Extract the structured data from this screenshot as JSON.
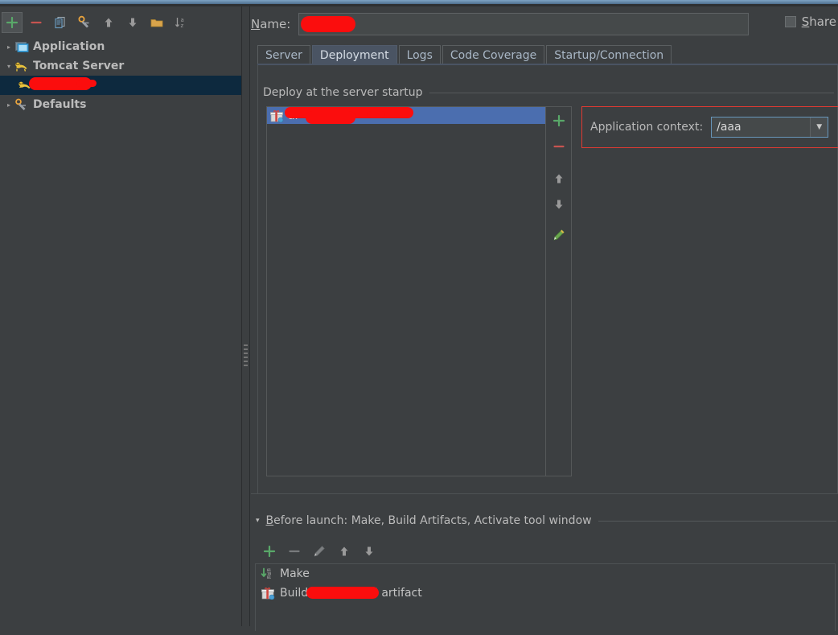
{
  "window": {
    "accent_title_color": "#6f96b8",
    "background": "#3c3f41",
    "selection_blue": "#4b6eaf",
    "tree_selection": "#0d293e",
    "redaction_color": "#fb0d0d",
    "error_border": "#e03a32",
    "focus_border": "#6897bb"
  },
  "left_toolbar": {
    "buttons": [
      {
        "name": "add-configuration-button",
        "icon": "plus-icon",
        "label": "Add New Configuration"
      },
      {
        "name": "remove-configuration-button",
        "icon": "minus-icon",
        "label": "Remove Configuration"
      },
      {
        "name": "copy-configuration-button",
        "icon": "copy-icon",
        "label": "Copy Configuration"
      },
      {
        "name": "edit-defaults-button",
        "icon": "wrench-icon",
        "label": "Edit defaults"
      },
      {
        "name": "move-up-button",
        "icon": "arrow-up-icon",
        "label": "Move Up"
      },
      {
        "name": "move-down-button",
        "icon": "arrow-down-icon",
        "label": "Move Down"
      },
      {
        "name": "create-folder-button",
        "icon": "folder-icon",
        "label": "Create New Folder"
      },
      {
        "name": "sort-button",
        "icon": "sort-az-icon",
        "label": "Sort Configurations"
      }
    ]
  },
  "tree": {
    "items": [
      {
        "label": "Application",
        "icon": "application-icon",
        "expanded": false,
        "level": 1,
        "selected": false,
        "redacted": false
      },
      {
        "label": "Tomcat Server",
        "icon": "tomcat-icon",
        "expanded": true,
        "level": 1,
        "selected": false,
        "redacted": false
      },
      {
        "label": "",
        "icon": "tomcat-icon",
        "expanded": null,
        "level": 2,
        "selected": true,
        "redacted": true
      },
      {
        "label": "Defaults",
        "icon": "wrench-icon",
        "expanded": false,
        "level": 1,
        "selected": false,
        "redacted": false
      }
    ]
  },
  "name_field": {
    "label": "Name:",
    "label_mnemonic": "N",
    "value": "",
    "redacted": true
  },
  "share": {
    "label": "Share",
    "label_mnemonic": "S",
    "checked": false
  },
  "tabs": [
    {
      "label": "Server",
      "active": false
    },
    {
      "label": "Deployment",
      "active": true
    },
    {
      "label": "Logs",
      "active": false
    },
    {
      "label": "Code Coverage",
      "active": false
    },
    {
      "label": "Startup/Connection",
      "active": false
    }
  ],
  "deployment": {
    "section_title": "Deploy at the server startup",
    "artifacts": [
      {
        "label": "ar",
        "icon": "artifact-icon",
        "selected": true,
        "redacted": true
      }
    ],
    "actions": [
      {
        "name": "add-artifact-button",
        "icon": "plus-icon",
        "label": "Add"
      },
      {
        "name": "remove-artifact-button",
        "icon": "minus-icon",
        "label": "Remove"
      },
      {
        "name": "move-artifact-up-button",
        "icon": "arrow-up-icon",
        "label": "Move Up"
      },
      {
        "name": "move-artifact-down-button",
        "icon": "arrow-down-icon",
        "label": "Move Down"
      },
      {
        "name": "edit-artifact-button",
        "icon": "pencil-icon",
        "label": "Edit"
      }
    ],
    "application_context": {
      "label": "Application context:",
      "value": "/aaa",
      "highlighted": true
    }
  },
  "before_launch": {
    "title": "Before launch: Make, Build Artifacts, Activate tool window",
    "title_mnemonic": "B",
    "expanded": true,
    "toolbar": [
      {
        "name": "add-task-button",
        "icon": "plus-icon",
        "label": "Add"
      },
      {
        "name": "remove-task-button",
        "icon": "minus-icon",
        "label": "Remove"
      },
      {
        "name": "edit-task-button",
        "icon": "pencil-icon",
        "label": "Edit"
      },
      {
        "name": "move-task-up-button",
        "icon": "arrow-up-icon",
        "label": "Move Up"
      },
      {
        "name": "move-task-down-button",
        "icon": "arrow-down-icon",
        "label": "Move Down"
      }
    ],
    "tasks": [
      {
        "label": "Make",
        "icon": "make-icon",
        "redacted": false
      },
      {
        "label_prefix": "Build '",
        "label_suffix": "r exploded' artifact",
        "icon": "artifact-icon",
        "redacted": true
      }
    ]
  }
}
